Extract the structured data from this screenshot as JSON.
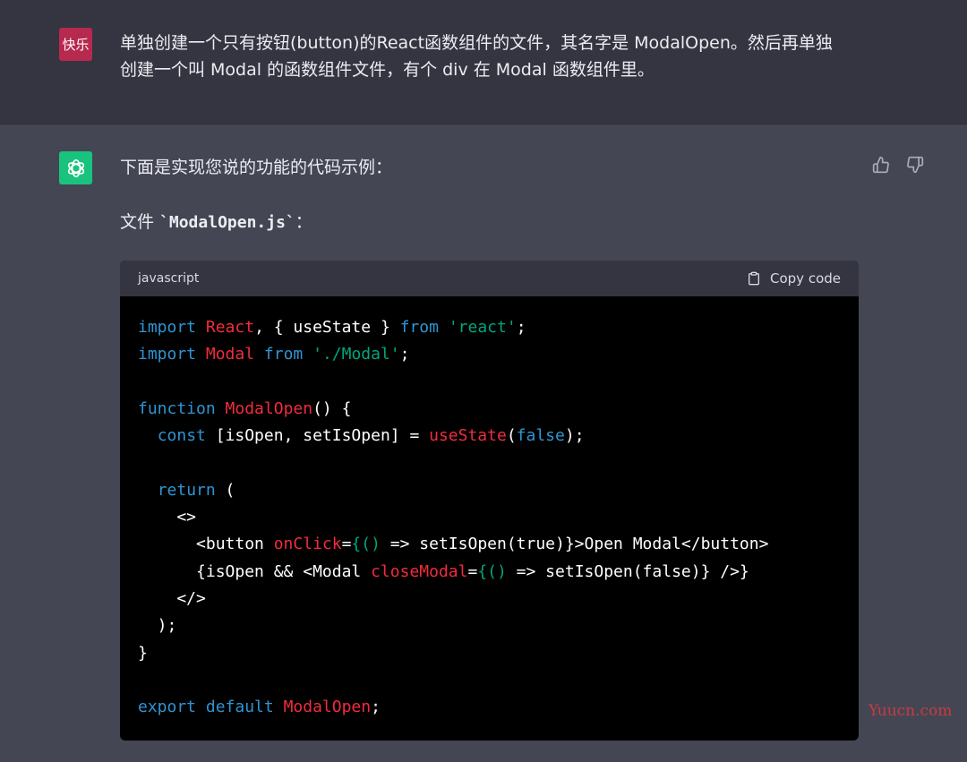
{
  "user_message": {
    "avatar_label": "快乐",
    "lines": [
      "单独创建一个只有按钮(button)的React函数组件的文件，其名字是 ModalOpen。然后再单独",
      "创建一个叫 Modal 的函数组件文件，有个 div 在 Modal 函数组件里。"
    ]
  },
  "assistant_message": {
    "intro": "下面是实现您说的功能的代码示例：",
    "file_prefix": "文件 ",
    "file_name": "`ModalOpen.js`",
    "file_suffix": "：",
    "feedback": {
      "like_icon": "thumbs-up-icon",
      "dislike_icon": "thumbs-down-icon"
    }
  },
  "code_block": {
    "language": "javascript",
    "copy_label": "Copy code",
    "lines": [
      [
        {
          "t": "import",
          "c": "kw"
        },
        {
          "t": " ",
          "c": "pl"
        },
        {
          "t": "React",
          "c": "id"
        },
        {
          "t": ", { useState } ",
          "c": "pl"
        },
        {
          "t": "from",
          "c": "kw"
        },
        {
          "t": " ",
          "c": "pl"
        },
        {
          "t": "'react'",
          "c": "str"
        },
        {
          "t": ";",
          "c": "pl"
        }
      ],
      [
        {
          "t": "import",
          "c": "kw"
        },
        {
          "t": " ",
          "c": "pl"
        },
        {
          "t": "Modal",
          "c": "id"
        },
        {
          "t": " ",
          "c": "pl"
        },
        {
          "t": "from",
          "c": "kw"
        },
        {
          "t": " ",
          "c": "pl"
        },
        {
          "t": "'./Modal'",
          "c": "str"
        },
        {
          "t": ";",
          "c": "pl"
        }
      ],
      [],
      [
        {
          "t": "function",
          "c": "kw"
        },
        {
          "t": " ",
          "c": "pl"
        },
        {
          "t": "ModalOpen",
          "c": "id"
        },
        {
          "t": "() {",
          "c": "pl"
        }
      ],
      [
        {
          "t": "  ",
          "c": "pl"
        },
        {
          "t": "const",
          "c": "kw"
        },
        {
          "t": " [isOpen, setIsOpen] = ",
          "c": "pl"
        },
        {
          "t": "useState",
          "c": "id"
        },
        {
          "t": "(",
          "c": "pl"
        },
        {
          "t": "false",
          "c": "kw"
        },
        {
          "t": ");",
          "c": "pl"
        }
      ],
      [],
      [
        {
          "t": "  ",
          "c": "pl"
        },
        {
          "t": "return",
          "c": "kw"
        },
        {
          "t": " (",
          "c": "pl"
        }
      ],
      [
        {
          "t": "    <>",
          "c": "pl"
        }
      ],
      [
        {
          "t": "      <button ",
          "c": "pl"
        },
        {
          "t": "onClick",
          "c": "id"
        },
        {
          "t": "=",
          "c": "pl"
        },
        {
          "t": "{() ",
          "c": "gr"
        },
        {
          "t": "=> setIsOpen(true)}>Open Modal</button>",
          "c": "pl"
        }
      ],
      [
        {
          "t": "      {isOpen && <Modal ",
          "c": "pl"
        },
        {
          "t": "closeModal",
          "c": "id"
        },
        {
          "t": "=",
          "c": "pl"
        },
        {
          "t": "{() ",
          "c": "gr"
        },
        {
          "t": "=> setIsOpen(false)} />}",
          "c": "pl"
        }
      ],
      [
        {
          "t": "    </>",
          "c": "pl"
        }
      ],
      [
        {
          "t": "  );",
          "c": "pl"
        }
      ],
      [
        {
          "t": "}",
          "c": "pl"
        }
      ],
      [],
      [
        {
          "t": "export",
          "c": "kw"
        },
        {
          "t": " ",
          "c": "pl"
        },
        {
          "t": "default",
          "c": "kw"
        },
        {
          "t": " ",
          "c": "pl"
        },
        {
          "t": "ModalOpen",
          "c": "id"
        },
        {
          "t": ";",
          "c": "pl"
        }
      ]
    ]
  },
  "watermark": "Yuucn.com",
  "colors": {
    "user_bg": "#343541",
    "assistant_bg": "#444654",
    "user_avatar": "#b7294e",
    "bot_avatar": "#19c37d",
    "keyword": "#2e95d3",
    "identifier": "#f22c3d",
    "string": "#00a67d"
  }
}
